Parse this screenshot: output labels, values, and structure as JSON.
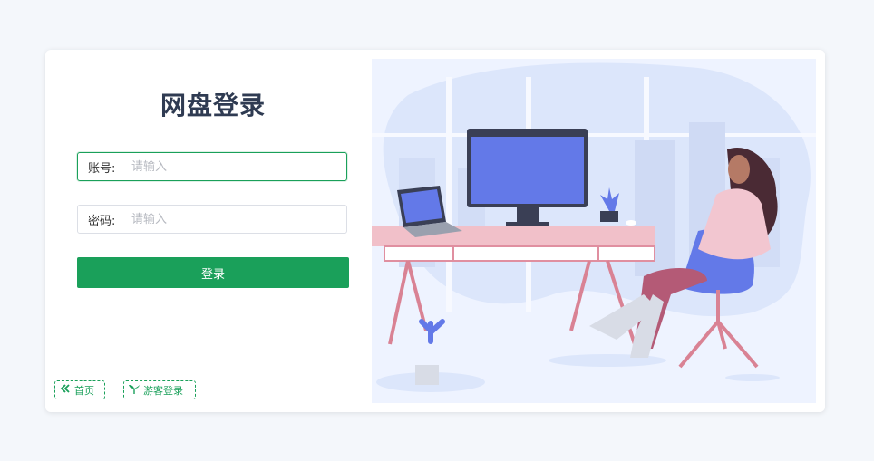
{
  "login": {
    "title": "网盘登录",
    "account_label": "账号:",
    "account_placeholder": "请输入",
    "password_label": "密码:",
    "password_placeholder": "请输入",
    "submit_label": "登录"
  },
  "links": {
    "home_label": "首页",
    "guest_label": "游客登录"
  },
  "colors": {
    "accent": "#1aa05a",
    "title": "#2f3b52",
    "illustration_bg": "#eef3ff",
    "monitor": "#6379e8",
    "desk": "#f1b9c3"
  },
  "icons": {
    "home": "double-chevron-left-icon",
    "guest": "sprout-icon"
  }
}
